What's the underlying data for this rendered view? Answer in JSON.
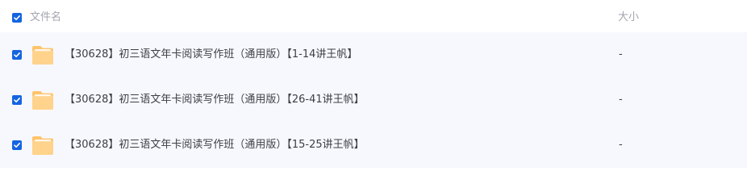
{
  "header": {
    "name_label": "文件名",
    "size_label": "大小",
    "select_all_checked": true
  },
  "files": [
    {
      "name": "【30628】初三语文年卡阅读写作班（通用版）【1-14讲王帆】",
      "size": "-",
      "checked": true,
      "icon": "folder-icon"
    },
    {
      "name": "【30628】初三语文年卡阅读写作班（通用版）【26-41讲王帆】",
      "size": "-",
      "checked": true,
      "icon": "folder-icon"
    },
    {
      "name": "【30628】初三语文年卡阅读写作班（通用版）【15-25讲王帆】",
      "size": "-",
      "checked": true,
      "icon": "folder-icon"
    }
  ],
  "colors": {
    "accent": "#1565e0",
    "row_background": "#f7f8fd",
    "folder": "#ffc46c"
  }
}
